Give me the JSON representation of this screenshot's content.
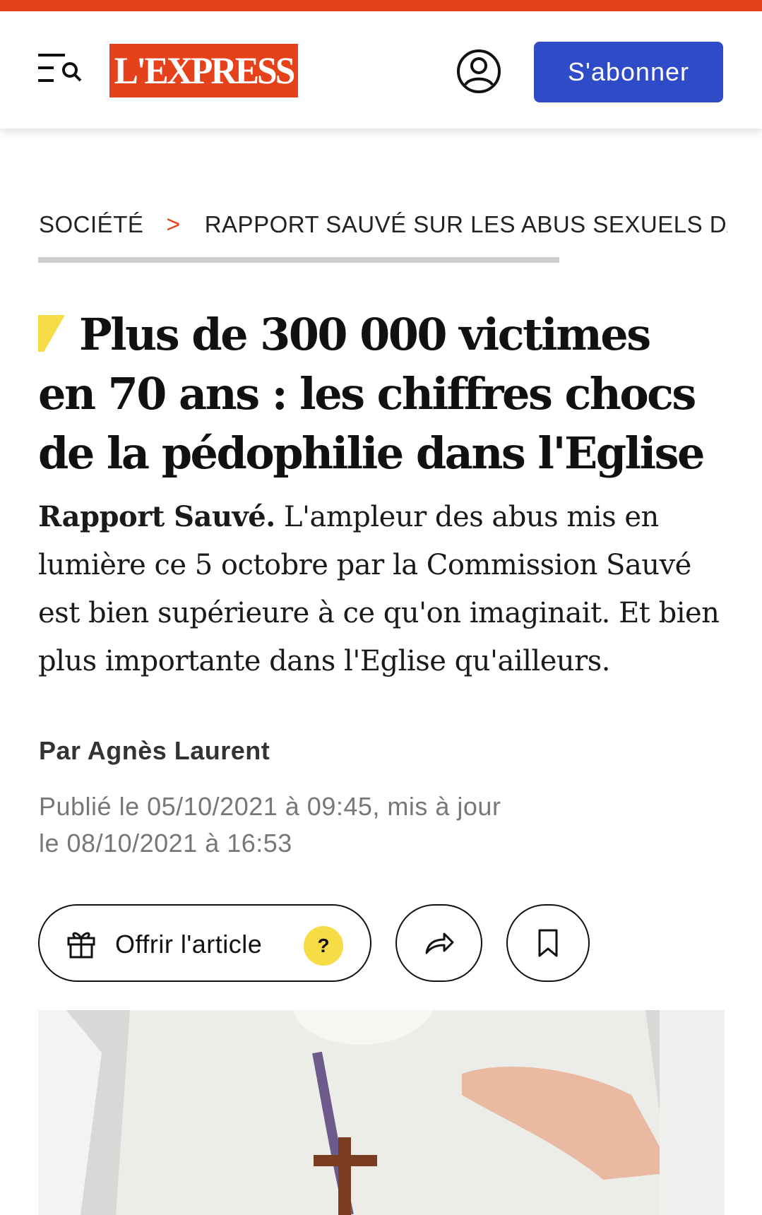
{
  "header": {
    "logo_text": "L'EXPRESS",
    "subscribe_label": "S'abonner",
    "menu_icon": "menu-search-icon",
    "account_icon": "user-account-icon",
    "brand_color": "#e5411b",
    "accent_color": "#2f4bc8"
  },
  "breadcrumb": {
    "section": "SOCIÉTÉ",
    "separator": ">",
    "topic": "RAPPORT SAUVÉ SUR LES ABUS SEXUELS DANS L'EGLISE"
  },
  "article": {
    "headline": "Plus de 300 000 victimes en 70 ans : les chiffres chocs de la pédophilie dans l'Eglise",
    "lede_kicker": "Rapport Sauvé.",
    "lede_text": "L'ampleur des abus mis en lumière ce 5 octobre par la Commission Sauvé est bien supérieure à ce qu'on imaginait. Et bien plus importante dans l'Eglise qu'ailleurs.",
    "byline": "Par Agnès Laurent",
    "published": "Publié le 05/10/2021 à 09:45, mis à jour",
    "updated": "le 08/10/2021 à 16:53"
  },
  "actions": {
    "gift_label": "Offrir l'article",
    "help_label": "?",
    "gift_icon": "gift-icon",
    "share_icon": "share-icon",
    "bookmark_icon": "bookmark-icon"
  }
}
